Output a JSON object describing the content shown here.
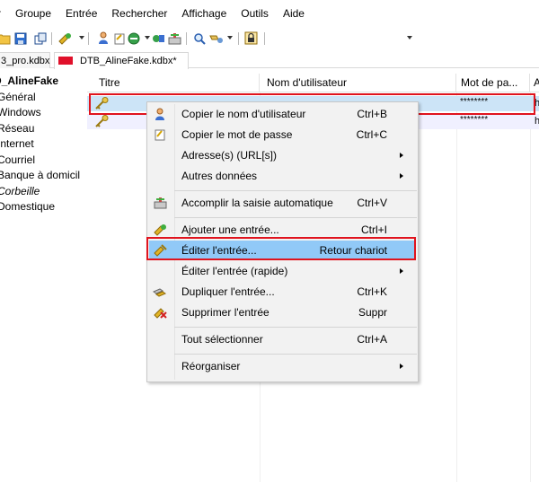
{
  "menubar": {
    "items": [
      "r",
      "Groupe",
      "Entrée",
      "Rechercher",
      "Affichage",
      "Outils",
      "Aide"
    ]
  },
  "toolbar": {
    "icons": [
      "open-folder-icon",
      "save-icon",
      "sync-icon",
      "add-entry-icon",
      "user-copy-icon",
      "key-copy-icon",
      "open-url-icon",
      "auto-type-icon",
      "find-icon",
      "find-options-icon",
      "lock-icon",
      "quick-search-dropdown-icon"
    ]
  },
  "tabs": [
    {
      "label": "3_pro.kdbx"
    },
    {
      "label": "DTB_AlineFake.kdbx*",
      "color": "#e0102a"
    }
  ],
  "tree": {
    "root": "D_AlineFake",
    "groups": [
      "Général",
      "Windows",
      "Réseau",
      "Internet",
      "Courriel",
      "Banque à domicil",
      "Corbeille",
      "Domestique"
    ]
  },
  "entry_list": {
    "columns": [
      "Titre",
      "Nom d'utilisateur",
      "Mot de pa...",
      "A"
    ],
    "rows": [
      {
        "password": "********",
        "extra": "h"
      },
      {
        "password": "********",
        "extra": "h"
      }
    ]
  },
  "context_menu": {
    "items": [
      {
        "label": "Copier le nom d'utilisateur",
        "shortcut": "Ctrl+B",
        "icon": "user-copy-icon"
      },
      {
        "label": "Copier le mot de passe",
        "shortcut": "Ctrl+C",
        "icon": "key-copy-icon"
      },
      {
        "label": "Adresse(s) (URL[s])",
        "shortcut": "",
        "icon": "",
        "submenu": true
      },
      {
        "label": "Autres données",
        "shortcut": "",
        "icon": "",
        "submenu": true
      },
      {
        "label": "Accomplir la saisie automatique",
        "shortcut": "Ctrl+V",
        "icon": "auto-type-icon"
      },
      {
        "label": "Ajouter une entrée...",
        "shortcut": "Ctrl+I",
        "icon": "add-entry-icon"
      },
      {
        "label": "Éditer l'entrée...",
        "shortcut": "Retour chariot",
        "icon": "edit-entry-icon",
        "highlighted": true
      },
      {
        "label": "Éditer l'entrée (rapide)",
        "shortcut": "",
        "icon": "",
        "submenu": true
      },
      {
        "label": "Dupliquer l'entrée...",
        "shortcut": "Ctrl+K",
        "icon": "duplicate-entry-icon"
      },
      {
        "label": "Supprimer l'entrée",
        "shortcut": "Suppr",
        "icon": "delete-entry-icon"
      },
      {
        "label": "Tout sélectionner",
        "shortcut": "Ctrl+A",
        "icon": ""
      },
      {
        "label": "Réorganiser",
        "shortcut": "",
        "icon": "",
        "submenu": true
      }
    ]
  },
  "colors": {
    "selection": "#cce4f7",
    "highlight": "#91c9f7",
    "annotation_red": "#e0141e"
  }
}
